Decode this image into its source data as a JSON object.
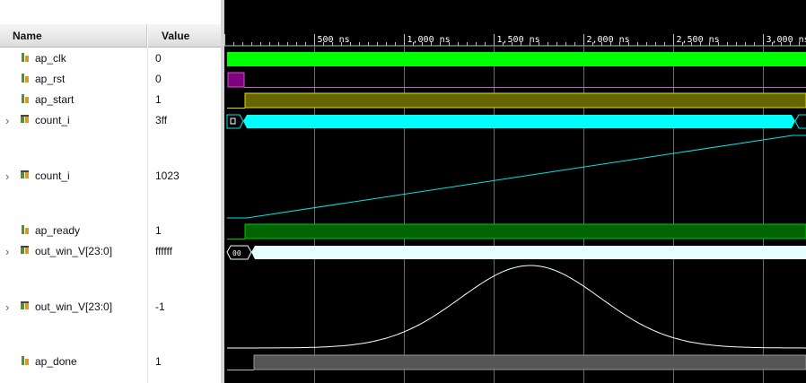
{
  "header": {
    "name": "Name",
    "value": "Value"
  },
  "timeline": {
    "ticks": [
      {
        "label": "500 ns",
        "ns": 500
      },
      {
        "label": "1,000 ns",
        "ns": 1000
      },
      {
        "label": "1,500 ns",
        "ns": 1500
      },
      {
        "label": "2,000 ns",
        "ns": 2000
      },
      {
        "label": "2,500 ns",
        "ns": 2500
      },
      {
        "label": "3,000 ns",
        "ns": 3000
      }
    ]
  },
  "signals": [
    {
      "name": "ap_clk",
      "value": "0",
      "icon": "signal-bit-icon",
      "expandable": false
    },
    {
      "name": "ap_rst",
      "value": "0",
      "icon": "signal-bit-icon",
      "expandable": false
    },
    {
      "name": "ap_start",
      "value": "1",
      "icon": "signal-bit-icon",
      "expandable": false
    },
    {
      "name": "count_i",
      "value": "3ff",
      "icon": "signal-bus-icon",
      "expandable": true
    },
    {
      "name": "count_i",
      "value": "1023",
      "icon": "signal-bus-icon",
      "expandable": true
    },
    {
      "name": "ap_ready",
      "value": "1",
      "icon": "signal-bit-icon",
      "expandable": false
    },
    {
      "name": "out_win_V[23:0]",
      "value": "ffffff",
      "icon": "signal-bus-icon",
      "expandable": true
    },
    {
      "name": "out_win_V[23:0]",
      "value": "-1",
      "icon": "signal-bus-icon",
      "expandable": true
    },
    {
      "name": "ap_done",
      "value": "1",
      "icon": "signal-bit-icon",
      "expandable": false
    }
  ],
  "waves": {
    "count_hex_labels": [
      "0"
    ],
    "out_win_hex_labels": [
      "00"
    ]
  },
  "colors": {
    "clk": "#00ff00",
    "rst": "#800080",
    "start": "#666600",
    "bus_cyan": "#00ffff",
    "ready": "#006400",
    "out_win": "#e8ffff",
    "done": "#555555",
    "grid": "#6b6b6b"
  }
}
